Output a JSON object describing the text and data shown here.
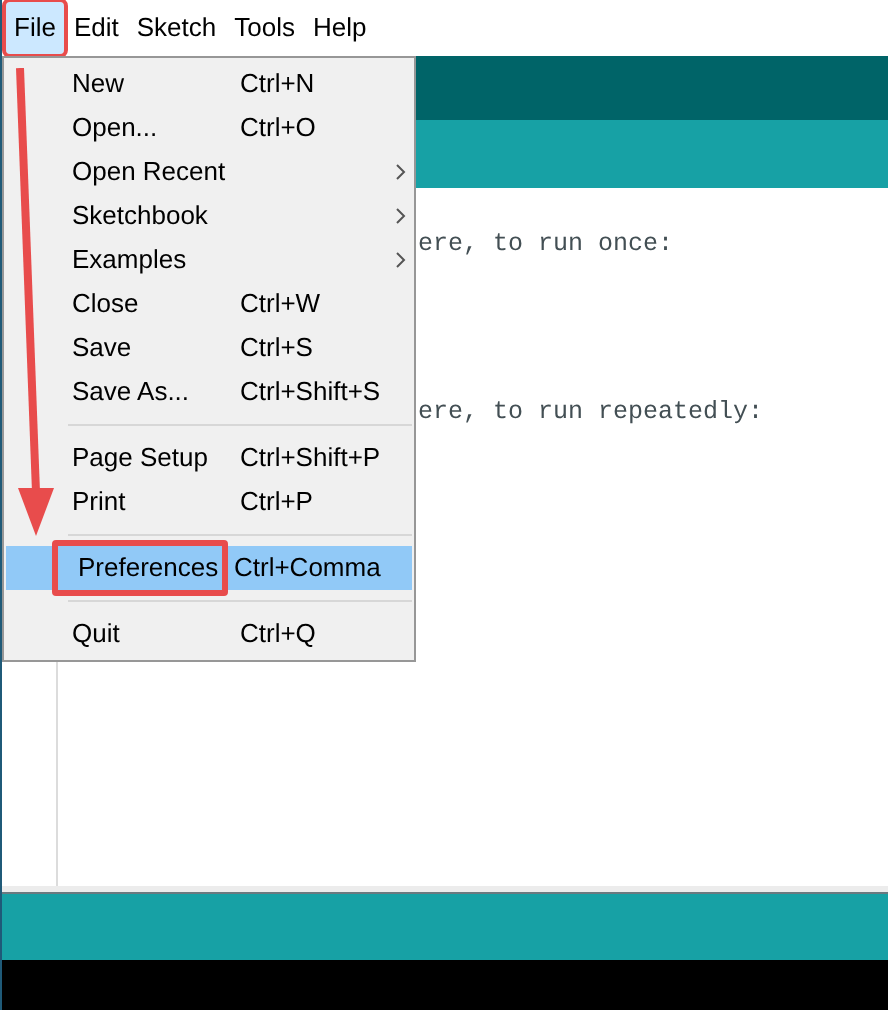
{
  "menu_bar": [
    {
      "label": "File",
      "selected": true
    },
    {
      "label": "Edit",
      "selected": false
    },
    {
      "label": "Sketch",
      "selected": false
    },
    {
      "label": "Tools",
      "selected": false
    },
    {
      "label": "Help",
      "selected": false
    }
  ],
  "file_menu": [
    {
      "kind": "item",
      "label": "New",
      "shortcut": "Ctrl+N",
      "submenu": false,
      "selected": false
    },
    {
      "kind": "item",
      "label": "Open...",
      "shortcut": "Ctrl+O",
      "submenu": false,
      "selected": false
    },
    {
      "kind": "item",
      "label": "Open Recent",
      "submenu": true,
      "selected": false
    },
    {
      "kind": "item",
      "label": "Sketchbook",
      "submenu": true,
      "selected": false
    },
    {
      "kind": "item",
      "label": "Examples",
      "submenu": true,
      "selected": false
    },
    {
      "kind": "item",
      "label": "Close",
      "shortcut": "Ctrl+W",
      "submenu": false,
      "selected": false
    },
    {
      "kind": "item",
      "label": "Save",
      "shortcut": "Ctrl+S",
      "submenu": false,
      "selected": false
    },
    {
      "kind": "item",
      "label": "Save As...",
      "shortcut": "Ctrl+Shift+S",
      "submenu": false,
      "selected": false
    },
    {
      "kind": "separator"
    },
    {
      "kind": "item",
      "label": "Page Setup",
      "shortcut": "Ctrl+Shift+P",
      "submenu": false,
      "selected": false
    },
    {
      "kind": "item",
      "label": "Print",
      "shortcut": "Ctrl+P",
      "submenu": false,
      "selected": false
    },
    {
      "kind": "separator"
    },
    {
      "kind": "item",
      "label": "Preferences",
      "shortcut": "Ctrl+Comma",
      "submenu": false,
      "selected": true
    },
    {
      "kind": "separator"
    },
    {
      "kind": "item",
      "label": "Quit",
      "shortcut": "Ctrl+Q",
      "submenu": false,
      "selected": false
    }
  ],
  "editor": {
    "code_lines": [
      {
        "text": "ere, to run once:"
      },
      {
        "text": "ere, to run repeatedly:"
      }
    ]
  }
}
